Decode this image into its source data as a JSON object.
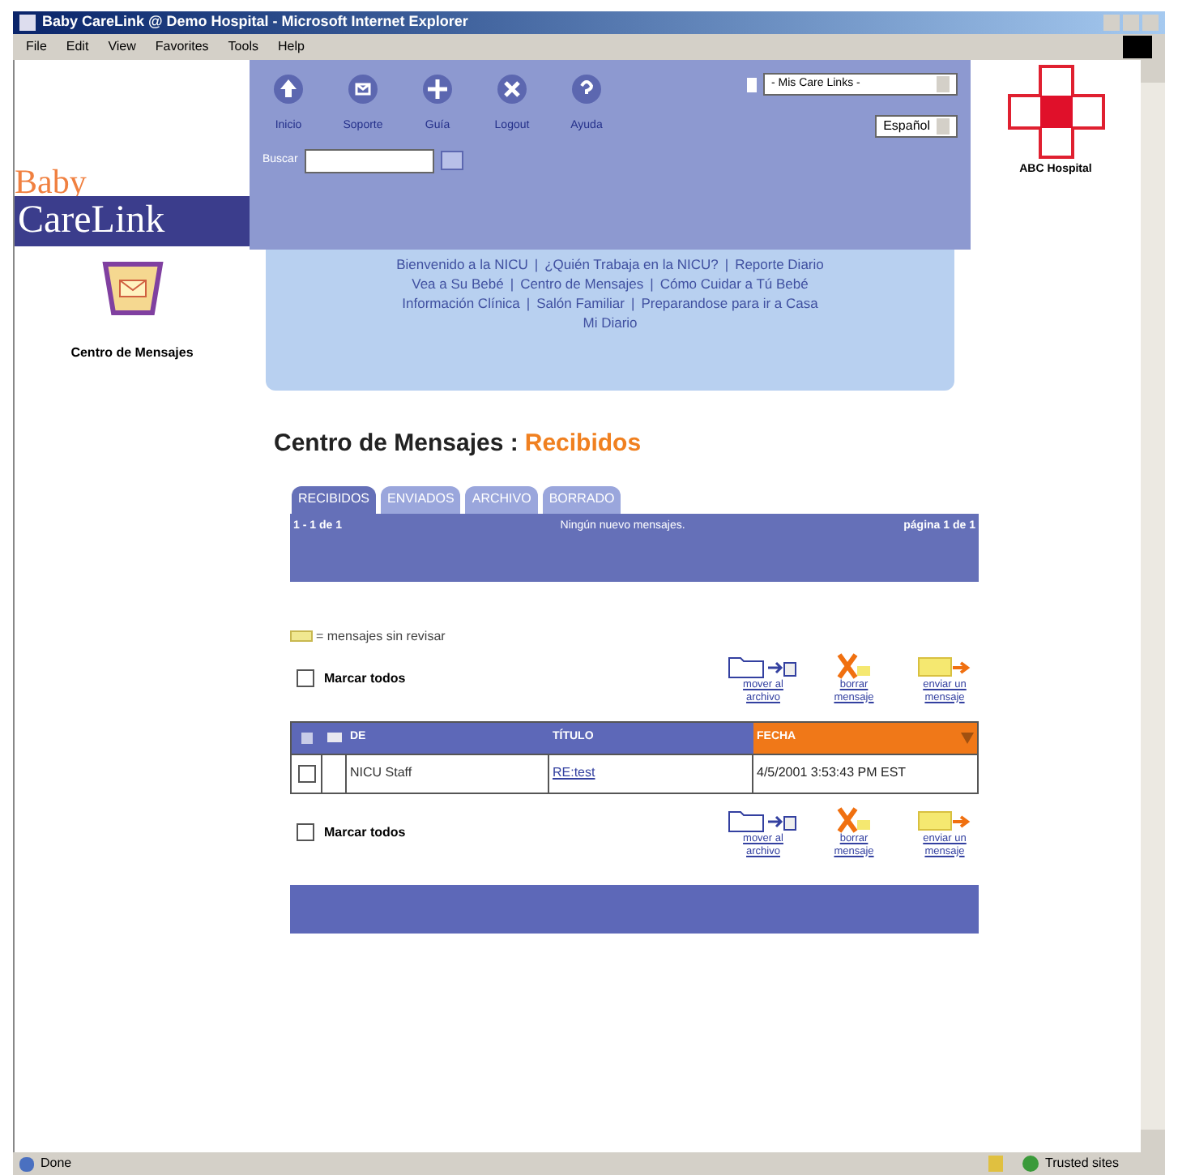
{
  "window": {
    "title": "Baby CareLink @ Demo Hospital - Microsoft Internet Explorer"
  },
  "menu": [
    "File",
    "Edit",
    "View",
    "Favorites",
    "Tools",
    "Help"
  ],
  "logo": {
    "top": "Baby",
    "bottom": "CareLink"
  },
  "sidebar": {
    "label": "Centro de Mensajes"
  },
  "nav": {
    "items": [
      {
        "label": "Inicio",
        "kind": "home"
      },
      {
        "label": "Soporte",
        "kind": "support"
      },
      {
        "label": "Guía",
        "kind": "guide"
      },
      {
        "label": "Logout",
        "kind": "logout"
      },
      {
        "label": "Ayuda",
        "kind": "help"
      }
    ],
    "search_label": "Buscar",
    "carelinks": "- Mis Care Links -",
    "language": "Español"
  },
  "hospital": {
    "name": "ABC Hospital"
  },
  "links": {
    "separator": "|",
    "lines": [
      [
        "Bienvenido a la NICU",
        "¿Quién Trabaja en la NICU?",
        "Reporte Diario"
      ],
      [
        "Vea a Su Bebé",
        "Centro de Mensajes",
        "Cómo Cuidar a Tú Bebé"
      ],
      [
        "Información Clínica",
        "Salón Familiar",
        "Preparandose para ir a Casa"
      ],
      [
        "Mi Diario"
      ]
    ]
  },
  "heading": {
    "title": "Centro de Mensajes :",
    "folder": "Recibidos"
  },
  "tabs": [
    {
      "label": "RECIBIDOS",
      "selected": true
    },
    {
      "label": "ENVIADOS",
      "selected": false
    },
    {
      "label": "ARCHIVO",
      "selected": false
    },
    {
      "label": "BORRADO",
      "selected": false
    }
  ],
  "summary": {
    "range": "1 - 1 de 1",
    "message": "Ningún nuevo mensajes.",
    "page": "página 1 de 1"
  },
  "legend": "= mensajes sin revisar",
  "toolbars": [
    {
      "mark_all": "Marcar todos",
      "checked": false,
      "actions": [
        {
          "kind": "archive",
          "label": "mover al archivo"
        },
        {
          "kind": "delete",
          "label": "borrar mensaje"
        },
        {
          "kind": "send",
          "label": "enviar un mensaje"
        }
      ]
    },
    {
      "mark_all": "Marcar todos",
      "checked": false,
      "actions": [
        {
          "kind": "archive",
          "label": "mover al archivo"
        },
        {
          "kind": "delete",
          "label": "borrar mensaje"
        },
        {
          "kind": "send",
          "label": "enviar un mensaje"
        }
      ]
    }
  ],
  "table": {
    "columns": [
      {
        "label": "DE",
        "sorted": false
      },
      {
        "label": "TÍTULO",
        "sorted": false
      },
      {
        "label": "FECHA",
        "sorted": true
      }
    ],
    "rows": [
      {
        "checked": false,
        "unread": false,
        "from": "NICU Staff",
        "title": "RE:test",
        "date": "4/5/2001 3:53:43 PM EST"
      }
    ]
  },
  "status_bar": {
    "text": "Done",
    "zone": "Trusted sites"
  }
}
